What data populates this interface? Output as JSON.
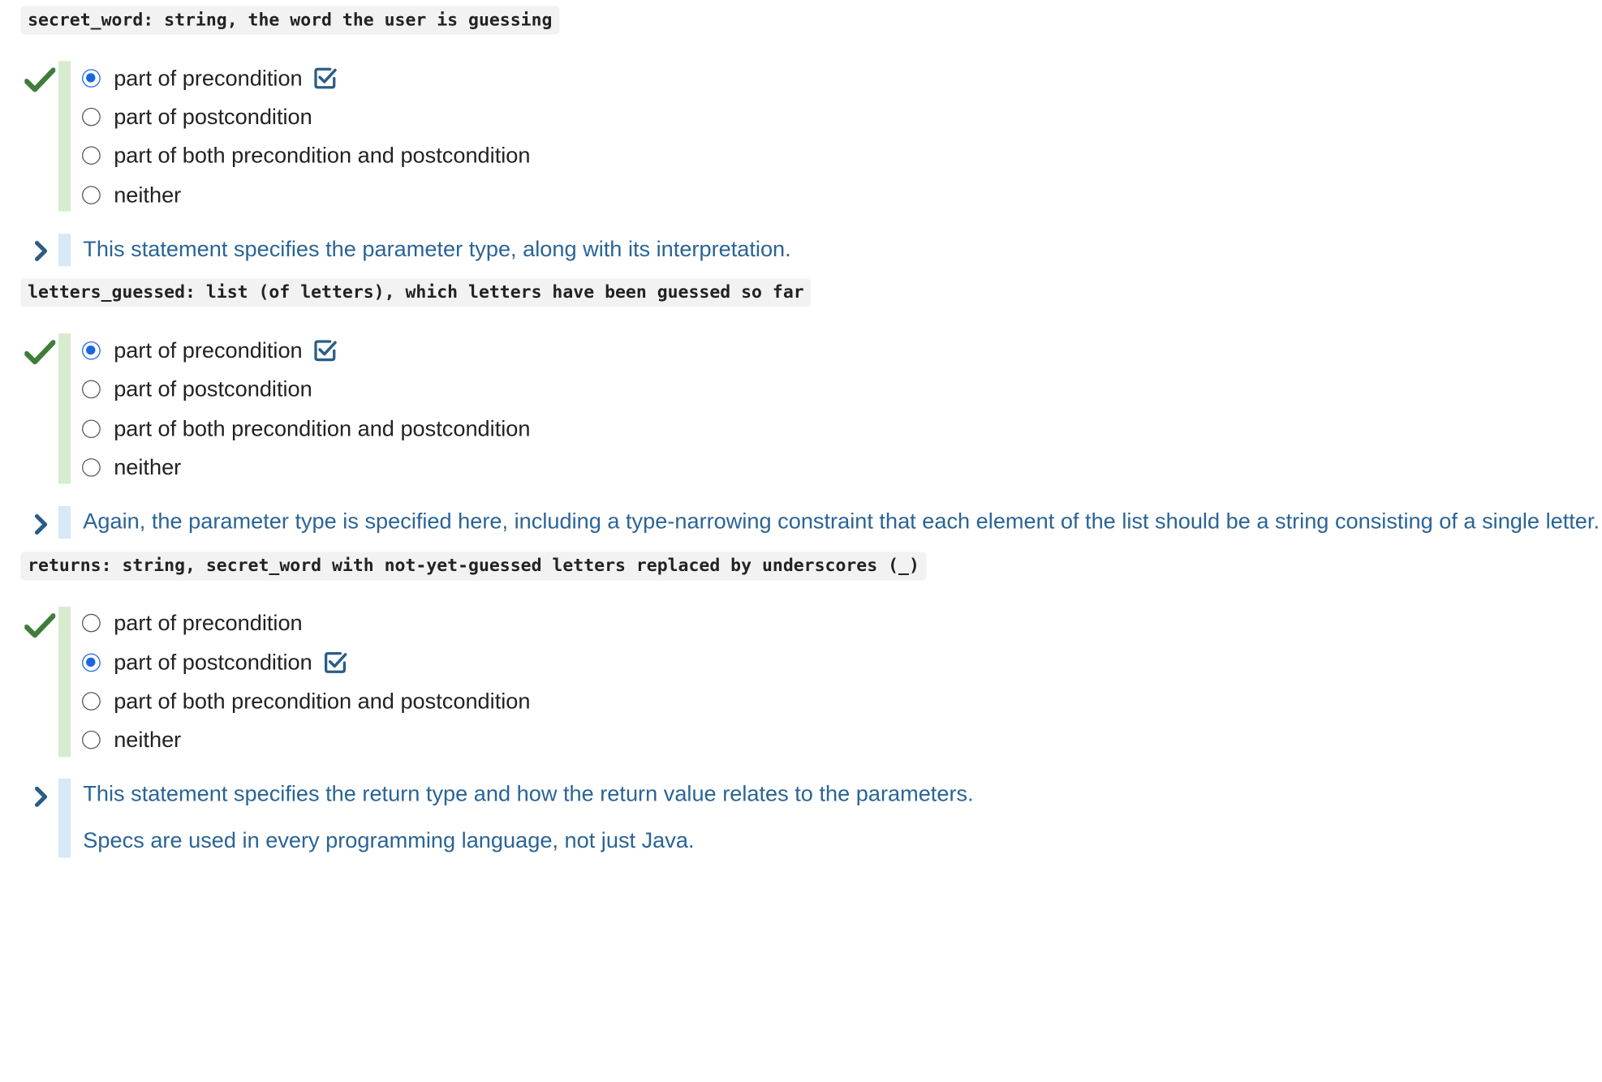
{
  "questions": [
    {
      "code": "secret_word: string, the word the user is guessing",
      "options": [
        "part of precondition",
        "part of postcondition",
        "part of both precondition and postcondition",
        "neither"
      ],
      "selected": 0,
      "correct": true,
      "feedback": [
        "This statement specifies the parameter type, along with its interpretation."
      ]
    },
    {
      "code": "letters_guessed: list (of letters), which letters have been guessed so far",
      "options": [
        "part of precondition",
        "part of postcondition",
        "part of both precondition and postcondition",
        "neither"
      ],
      "selected": 0,
      "correct": true,
      "feedback": [
        "Again, the parameter type is specified here, including a type-narrowing constraint that each element of the list should be a string consisting of a single letter."
      ]
    },
    {
      "code": "returns: string, secret_word with not-yet-guessed letters replaced by underscores (_)",
      "options": [
        "part of precondition",
        "part of postcondition",
        "part of both precondition and postcondition",
        "neither"
      ],
      "selected": 1,
      "correct": true,
      "feedback": [
        "This statement specifies the return type and how the return value relates to the parameters.",
        "Specs are used in every programming language, not just Java."
      ]
    }
  ],
  "colors": {
    "correct_check": "#3e7d3a",
    "selected_radio": "#1a66e0",
    "feedback_text": "#2a6496",
    "green_bar": "#d6ecd0",
    "blue_bar": "#d7e8f6",
    "chevron": "#2a5d86"
  },
  "icons": {
    "correct": "checkmark-icon",
    "chosen": "checked-box-icon",
    "expand": "chevron-right-icon"
  }
}
